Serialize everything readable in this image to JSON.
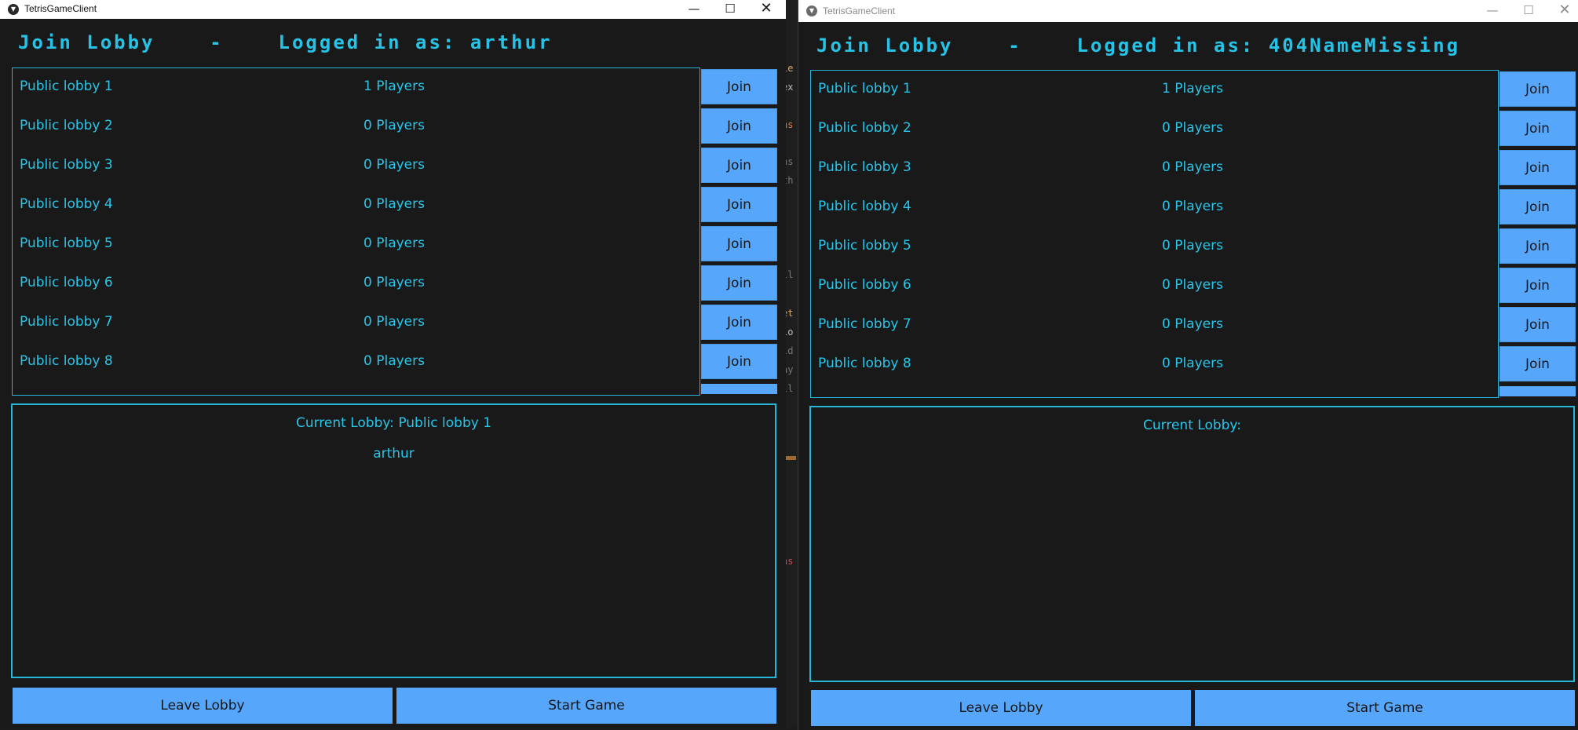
{
  "windows": [
    {
      "title": "TetrisGameClient",
      "heading": "Join Lobby    -    Logged in as: arthur",
      "current_lobby_label": "Current Lobby: Public lobby 1",
      "members": [
        "arthur"
      ]
    },
    {
      "title": "TetrisGameClient",
      "heading": "Join Lobby    -    Logged in as: 404NameMissing",
      "current_lobby_label": "Current Lobby:",
      "members": []
    }
  ],
  "lobbies": [
    {
      "name": "Public lobby 1",
      "players": "1 Players"
    },
    {
      "name": "Public lobby 2",
      "players": "0 Players"
    },
    {
      "name": "Public lobby 3",
      "players": "0 Players"
    },
    {
      "name": "Public lobby 4",
      "players": "0 Players"
    },
    {
      "name": "Public lobby 5",
      "players": "0 Players"
    },
    {
      "name": "Public lobby 6",
      "players": "0 Players"
    },
    {
      "name": "Public lobby 7",
      "players": "0 Players"
    },
    {
      "name": "Public lobby 8",
      "players": "0 Players"
    }
  ],
  "buttons": {
    "join": "Join",
    "leave_lobby": "Leave Lobby",
    "start_game": "Start Game"
  },
  "window_controls": {
    "minimize": "—",
    "maximize": "☐",
    "close": "✕"
  },
  "icons": {
    "app": "app-logo-icon"
  },
  "background_code": [
    ":",
    "ie",
    "ex",
    "ns",
    "ns",
    "th",
    "ll",
    "et",
    "lo",
    "ld",
    "ay",
    "ll",
    "as"
  ],
  "colors": {
    "background": "#191919",
    "accent_text": "#29c6ea",
    "button": "#56a7fb",
    "button_text": "#161616"
  }
}
